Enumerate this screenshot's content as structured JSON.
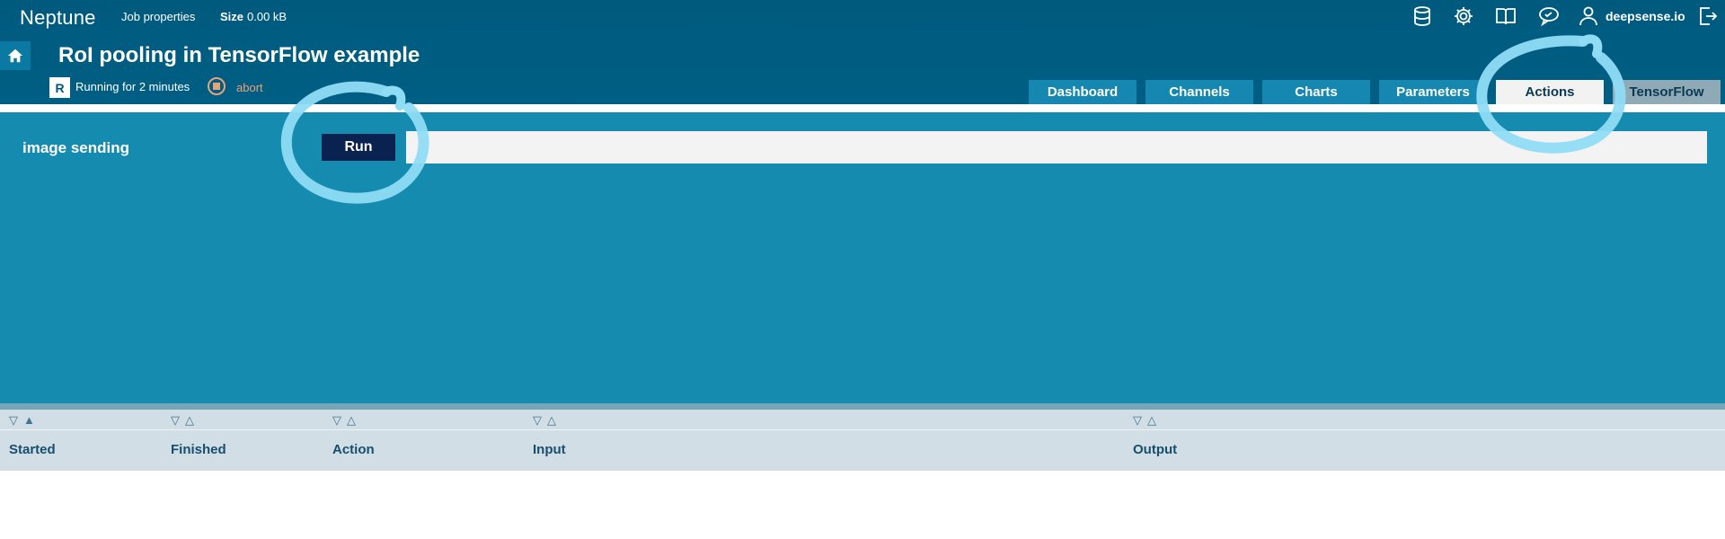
{
  "header": {
    "brand": "Neptune",
    "job_properties": "Job properties",
    "size_label": "Size",
    "size_value": "0.00 kB",
    "user_name": "deepsense.io",
    "icons": [
      "database-icon",
      "settings-gear-icon",
      "book-icon",
      "chat-icon",
      "user-icon",
      "logout-icon"
    ]
  },
  "job": {
    "title": "RoI pooling in TensorFlow example",
    "status_badge": "R",
    "status_text": "Running for 2 minutes",
    "abort_label": "abort"
  },
  "tabs": [
    {
      "label": "Dashboard",
      "active": false
    },
    {
      "label": "Channels",
      "active": false
    },
    {
      "label": "Charts",
      "active": false
    },
    {
      "label": "Parameters",
      "active": false
    },
    {
      "label": "Actions",
      "active": true
    },
    {
      "label": "TensorFlow",
      "active": false
    }
  ],
  "actions": {
    "name": "image sending",
    "run_label": "Run",
    "input_value": ""
  },
  "table": {
    "columns": [
      "Started",
      "Finished",
      "Action",
      "Input",
      "Output"
    ]
  },
  "colors": {
    "header_bg": "#005a7e",
    "panel_bg": "#168bb0",
    "tab_bg": "#1587b0",
    "run_button_bg": "#0a2250",
    "abort_color": "#e8a179",
    "annotation_circle": "#8fdcf5"
  }
}
